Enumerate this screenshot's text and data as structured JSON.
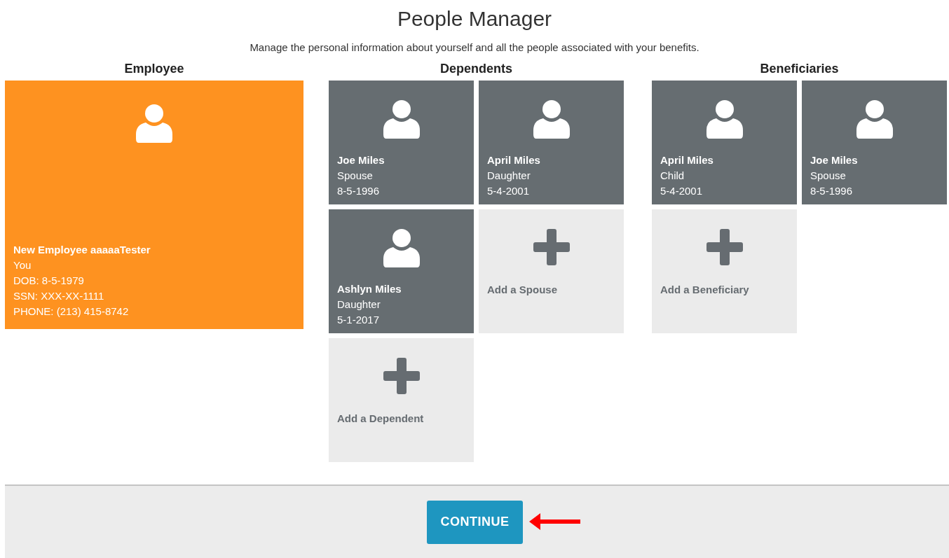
{
  "header": {
    "title": "People Manager",
    "subtitle": "Manage the personal information about yourself and all the people associated with your benefits."
  },
  "employee": {
    "heading": "Employee",
    "name": "New Employee aaaaaTester",
    "lines": [
      "You",
      "DOB: 8-5-1979",
      "SSN: XXX-XX-1111",
      "PHONE: (213) 415-8742"
    ]
  },
  "dependents": {
    "heading": "Dependents",
    "cards": [
      {
        "kind": "person",
        "name": "Joe Miles",
        "relation": "Spouse",
        "date": "8-5-1996"
      },
      {
        "kind": "person",
        "name": "April Miles",
        "relation": "Daughter",
        "date": "5-4-2001"
      },
      {
        "kind": "person",
        "name": "Ashlyn Miles",
        "relation": "Daughter",
        "date": "5-1-2017"
      },
      {
        "kind": "add",
        "label": "Add a Spouse"
      },
      {
        "kind": "add",
        "label": "Add a Dependent"
      }
    ]
  },
  "beneficiaries": {
    "heading": "Beneficiaries",
    "cards": [
      {
        "kind": "person",
        "name": "April Miles",
        "relation": "Child",
        "date": "5-4-2001"
      },
      {
        "kind": "person",
        "name": "Joe Miles",
        "relation": "Spouse",
        "date": "8-5-1996"
      },
      {
        "kind": "add",
        "label": "Add a Beneficiary"
      }
    ]
  },
  "footer": {
    "button": "CONTINUE"
  }
}
